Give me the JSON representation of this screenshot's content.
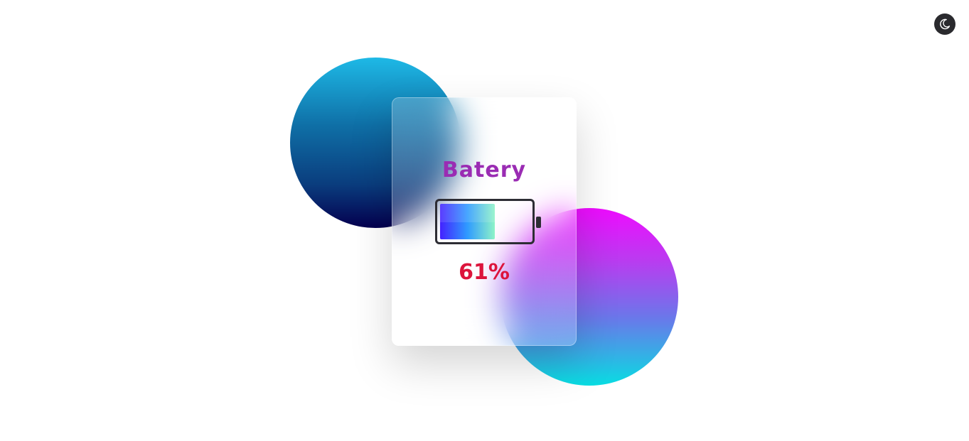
{
  "theme_toggle": {
    "icon": "moon-icon"
  },
  "card": {
    "title": "Batery",
    "battery": {
      "level": 0.61,
      "percent_text": "61%"
    }
  },
  "colors": {
    "title": "#9a2cb3",
    "percent": "#dc143c",
    "battery_outline": "#2d2d34",
    "toggle_bg": "#2a2a2e",
    "fill_gradient": [
      "#4422ff",
      "#2f9bff",
      "#8ef3c8"
    ],
    "circle_top_gradient": [
      "#1eb9e6",
      "#04004f"
    ],
    "circle_bottom_gradient": [
      "#ee0cff",
      "#08dde2"
    ]
  }
}
